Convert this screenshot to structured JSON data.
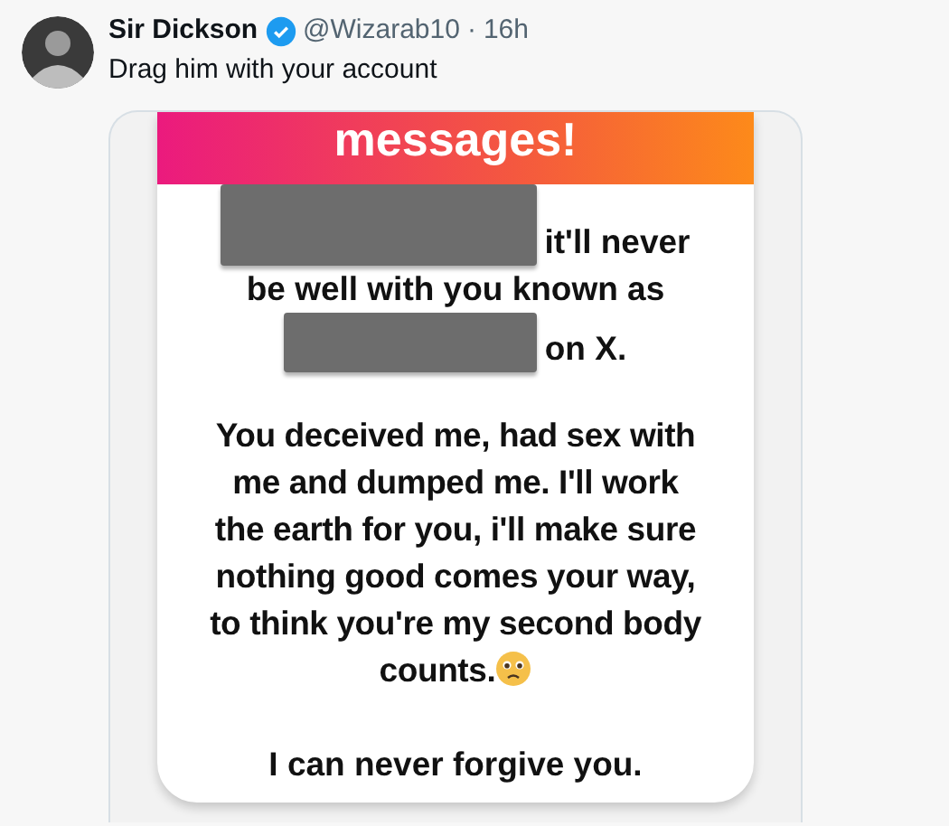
{
  "tweet": {
    "author": "Sir Dickson",
    "verified": true,
    "handle": "@Wizarab10",
    "separator": "·",
    "time": "16h",
    "text": "Drag him with your account"
  },
  "media": {
    "header_text": "messages!",
    "lines": [
      [
        {
          "kind": "redacted"
        },
        {
          "kind": "text",
          "text": "it'll never"
        }
      ],
      [
        {
          "kind": "text",
          "text": "be well with you known as"
        }
      ],
      [
        {
          "kind": "redacted"
        },
        {
          "kind": "text",
          "text": "on X."
        }
      ]
    ],
    "paragraph": [
      "You deceived me, had sex with",
      "me and dumped me. I'll work",
      "the earth for you, i'll make sure",
      "nothing good comes your way,",
      "to think you're my second body",
      "counts."
    ],
    "paragraph_emoji": true,
    "closing": "I can never forgive you."
  }
}
